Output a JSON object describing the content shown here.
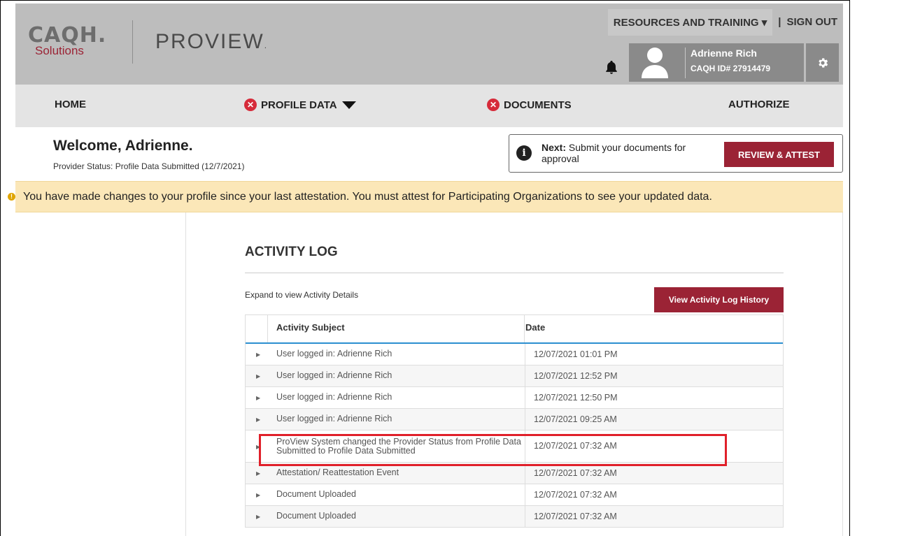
{
  "header": {
    "logo_caqh": "CAQH.",
    "logo_solutions": "Solutions",
    "logo_proview": "PROVIEW",
    "logo_proview_dot": ".",
    "resources_link": "RESOURCES AND TRAINING ▾",
    "separator": "|",
    "signout_link": "SIGN OUT",
    "user_name": "Adrienne Rich",
    "user_id": "CAQH ID# 27914479"
  },
  "nav": {
    "home": "HOME",
    "profile_data": "PROFILE DATA",
    "documents": "DOCUMENTS",
    "authorize": "AUTHORIZE"
  },
  "welcome": {
    "title": "Welcome, Adrienne.",
    "status": "Provider Status:  Profile Data Submitted (12/7/2021)"
  },
  "next": {
    "label": "Next:",
    "text": " Submit your documents for approval",
    "button": "REVIEW & ATTEST"
  },
  "alert": {
    "text": "You have made changes to your profile since your last attestation. You must attest for Participating Organizations to see your updated data."
  },
  "activity": {
    "title": "ACTIVITY LOG",
    "expand_text": "Expand to view Activity Details",
    "history_button": "View Activity Log History",
    "columns": {
      "subject": "Activity Subject",
      "date": "Date"
    },
    "rows": [
      {
        "subject": "User logged in: Adrienne Rich",
        "date": "12/07/2021 01:01 PM"
      },
      {
        "subject": "User logged in: Adrienne Rich",
        "date": "12/07/2021 12:52 PM"
      },
      {
        "subject": "User logged in: Adrienne Rich",
        "date": "12/07/2021 12:50 PM"
      },
      {
        "subject": "User logged in: Adrienne Rich",
        "date": "12/07/2021 09:25 AM"
      },
      {
        "subject": "ProView System changed the Provider Status from Profile Data Submitted to Profile Data Submitted",
        "date": "12/07/2021 07:32 AM"
      },
      {
        "subject": "Attestation/ Reattestation Event",
        "date": "12/07/2021 07:32 AM"
      },
      {
        "subject": "Document Uploaded",
        "date": "12/07/2021 07:32 AM"
      },
      {
        "subject": "Document Uploaded",
        "date": "12/07/2021 07:32 AM"
      }
    ]
  },
  "colors": {
    "brand_red": "#9b2335",
    "header_gray": "#bdbdbd",
    "nav_gray": "#e4e4e4",
    "alert_yellow": "#fbe7b8",
    "highlight_red": "#e0202a",
    "table_accent": "#2b8fd0"
  },
  "icons": {
    "bell": "bell-icon",
    "avatar": "avatar-icon",
    "gear": "gear-icon",
    "error": "x-circle-icon",
    "info": "info-icon",
    "warning": "warning-icon",
    "expand": "caret-right-icon",
    "dropdown": "caret-down-icon"
  }
}
